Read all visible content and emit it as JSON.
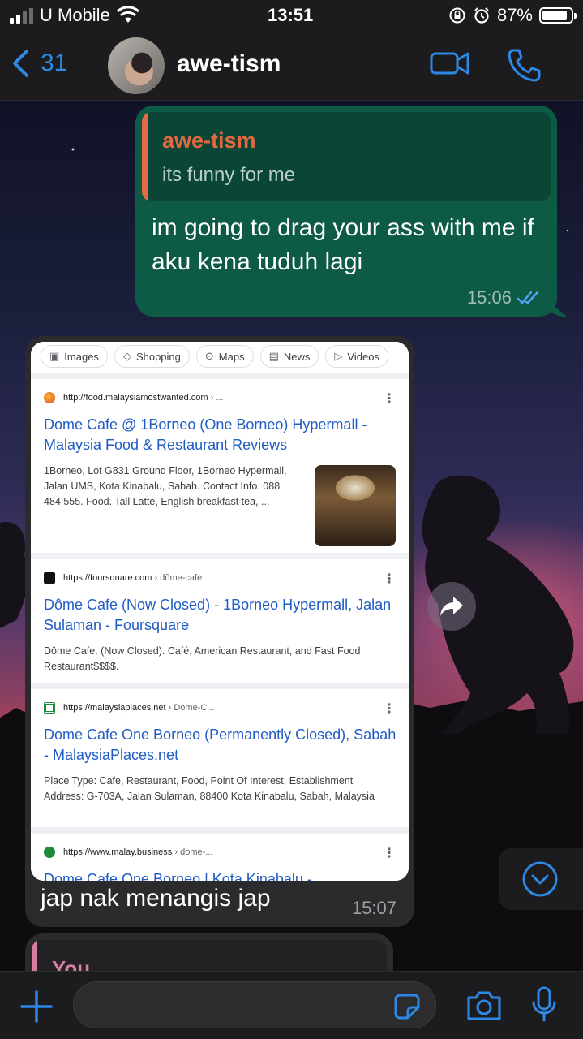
{
  "status_bar": {
    "carrier": "U Mobile",
    "time": "13:51",
    "battery_percent": "87%",
    "battery_level": 0.87
  },
  "header": {
    "back_count": "31",
    "contact_name": "awe-tism"
  },
  "messages": {
    "outgoing": {
      "quoted_author": "awe-tism",
      "quoted_text": "its funny for me",
      "text": "im going to drag your ass with me if aku kena tuduh lagi",
      "time": "15:06",
      "status": "read"
    },
    "incoming": {
      "text": "jap nak menangis jap",
      "time": "15:07",
      "screenshot": {
        "tabs": [
          "Images",
          "Shopping",
          "Maps",
          "News",
          "Videos"
        ],
        "results": [
          {
            "url": "http://food.malaysiamostwanted.com",
            "crumb": "› ...",
            "title": "Dome Cafe @ 1Borneo (One Borneo) Hypermall - Malaysia Food & Restaurant Reviews",
            "snippet": "1Borneo, Lot G831 Ground Floor, 1Borneo Hypermall, Jalan UMS, Kota Kinabalu, Sabah. Contact Info. 088 484 555. Food. Tall Latte, English breakfast tea, ..."
          },
          {
            "url": "https://foursquare.com",
            "crumb": "› dôme-cafe",
            "title": "Dôme Cafe (Now Closed) - 1Borneo Hypermall, Jalan Sulaman - Foursquare",
            "snippet": "Dôme Cafe. (Now Closed). Café, American Restaurant, and Fast Food Restaurant$$$$."
          },
          {
            "url": "https://malaysiaplaces.net",
            "crumb": "› Dome-C...",
            "title": "Dome Cafe One Borneo (Permanently Closed), Sabah - MalaysiaPlaces.net",
            "snippet": "Place Type: Cafe, Restaurant, Food, Point Of Interest, Establishment Address: G-703A, Jalan Sulaman, 88400 Kota Kinabalu, Sabah, Malaysia"
          },
          {
            "url": "https://www.malay.business",
            "crumb": "› dome-...",
            "title": "Dome Cafe One Borneo | Kota Kinabalu -"
          }
        ]
      }
    },
    "peek": {
      "quoted_author": "You"
    }
  },
  "colors": {
    "accent": "#2d88e6",
    "outgoing_bubble": "#0d5b45",
    "incoming_bubble": "#2b2b2d",
    "quote_author": "#e1683f",
    "link_title": "#1f5cc4"
  }
}
